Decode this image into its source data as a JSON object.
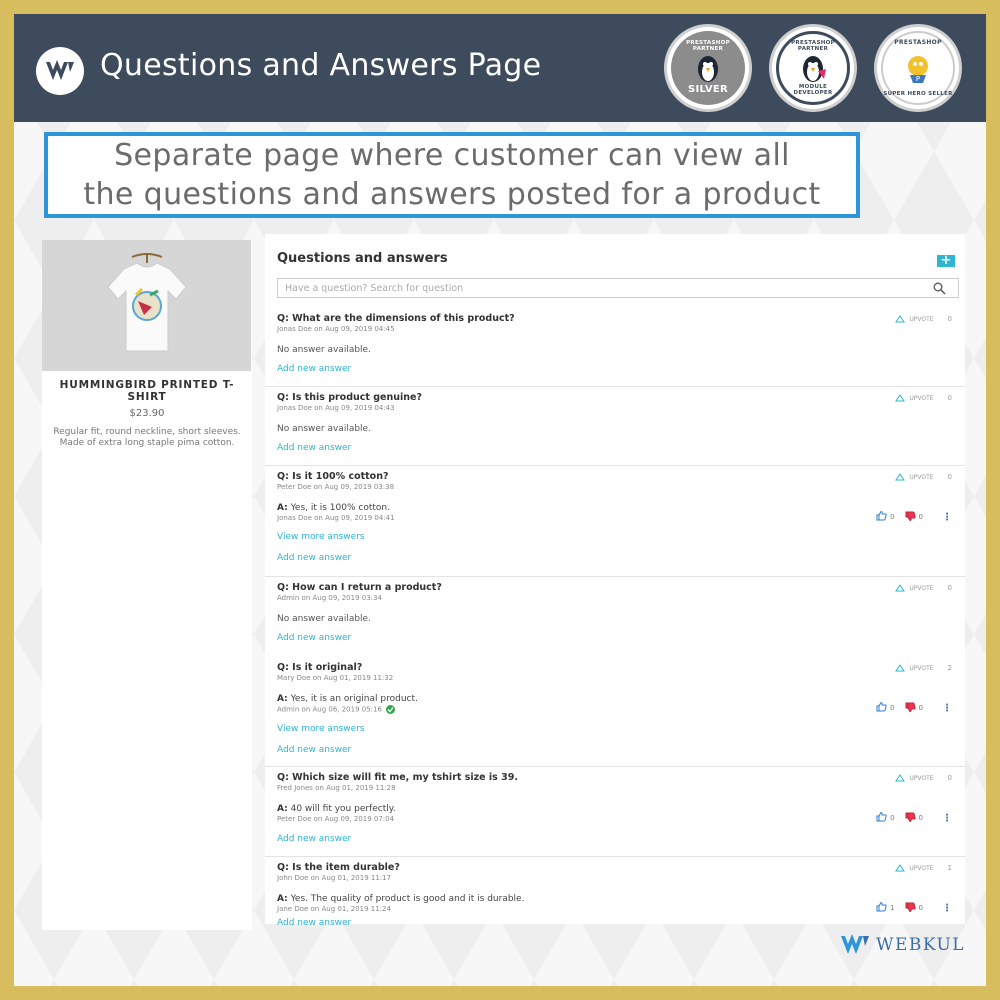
{
  "header": {
    "title": "Questions and Answers Page",
    "badges": [
      {
        "top_text": "PRESTASHOP PARTNER",
        "bottom_text": "SILVER"
      },
      {
        "top_text": "PRESTASHOP PARTNER",
        "bottom_text": "MODULE DEVELOPER"
      },
      {
        "top_text": "PRESTASHOP",
        "bottom_text": "SUPER HERO SELLER"
      }
    ]
  },
  "callout": {
    "line1": "Separate page where customer can view all",
    "line2": "the questions and answers posted for a product"
  },
  "product": {
    "name": "HUMMINGBIRD PRINTED T-SHIRT",
    "price": "$23.90",
    "description": "Regular fit, round neckline, short sleeves. Made of extra long staple pima cotton."
  },
  "qa": {
    "title": "Questions and answers",
    "add_label": "+",
    "search_placeholder": "Have a question? Search for question",
    "upvote_label": "UPVOTE",
    "no_answer": "No answer available.",
    "add_answer": "Add new answer",
    "view_more": "View more answers",
    "questions": [
      {
        "q": "Q: What are the dimensions of this product?",
        "meta": "Jonas Doe on Aug 09, 2019 04:45",
        "upvotes": "0"
      },
      {
        "q": "Q: Is this product genuine?",
        "meta": "Jonas Doe on Aug 09, 2019 04:43",
        "upvotes": "0"
      },
      {
        "q": "Q: Is it 100% cotton?",
        "meta": "Peter Doe on Aug 09, 2019 03:38",
        "upvotes": "0",
        "answer": "Yes, it is 100% cotton.",
        "answer_meta": "Jonas Doe on Aug 09, 2019 04:41",
        "likes": "0",
        "dislikes": "0"
      },
      {
        "q": "Q: How can I return a product?",
        "meta": "Admin on Aug 09, 2019 03:34",
        "upvotes": "0"
      },
      {
        "q": "Q: Is it original?",
        "meta": "Mary Doe on Aug 01, 2019 11:32",
        "upvotes": "2",
        "answer": "Yes, it is an original product.",
        "answer_meta": "Admin on Aug 06, 2019 05:16",
        "likes": "0",
        "dislikes": "0"
      },
      {
        "q": "Q: Which size will fit me, my tshirt size is 39.",
        "meta": "Fred Jones on Aug 01, 2019 11:28",
        "upvotes": "0",
        "answer": "40 will fit you perfectly.",
        "answer_meta": "Peter Doe on Aug 09, 2019 07:04",
        "likes": "0",
        "dislikes": "0"
      },
      {
        "q": "Q: Is the item durable?",
        "meta": "John Doe on Aug 01, 2019 11:17",
        "upvotes": "1",
        "answer": "Yes. The quality of product is good and it is durable.",
        "answer_meta": "Jane Doe on Aug 01, 2019 11:24",
        "likes": "1",
        "dislikes": "0"
      }
    ],
    "answer_prefix": "A:"
  },
  "footer": {
    "brand": "WEBKUL"
  },
  "colors": {
    "header_bg": "#3d4b5c",
    "accent": "#2fb5d2",
    "frame": "#d8bd5f",
    "callout_border": "#2f95d9"
  }
}
